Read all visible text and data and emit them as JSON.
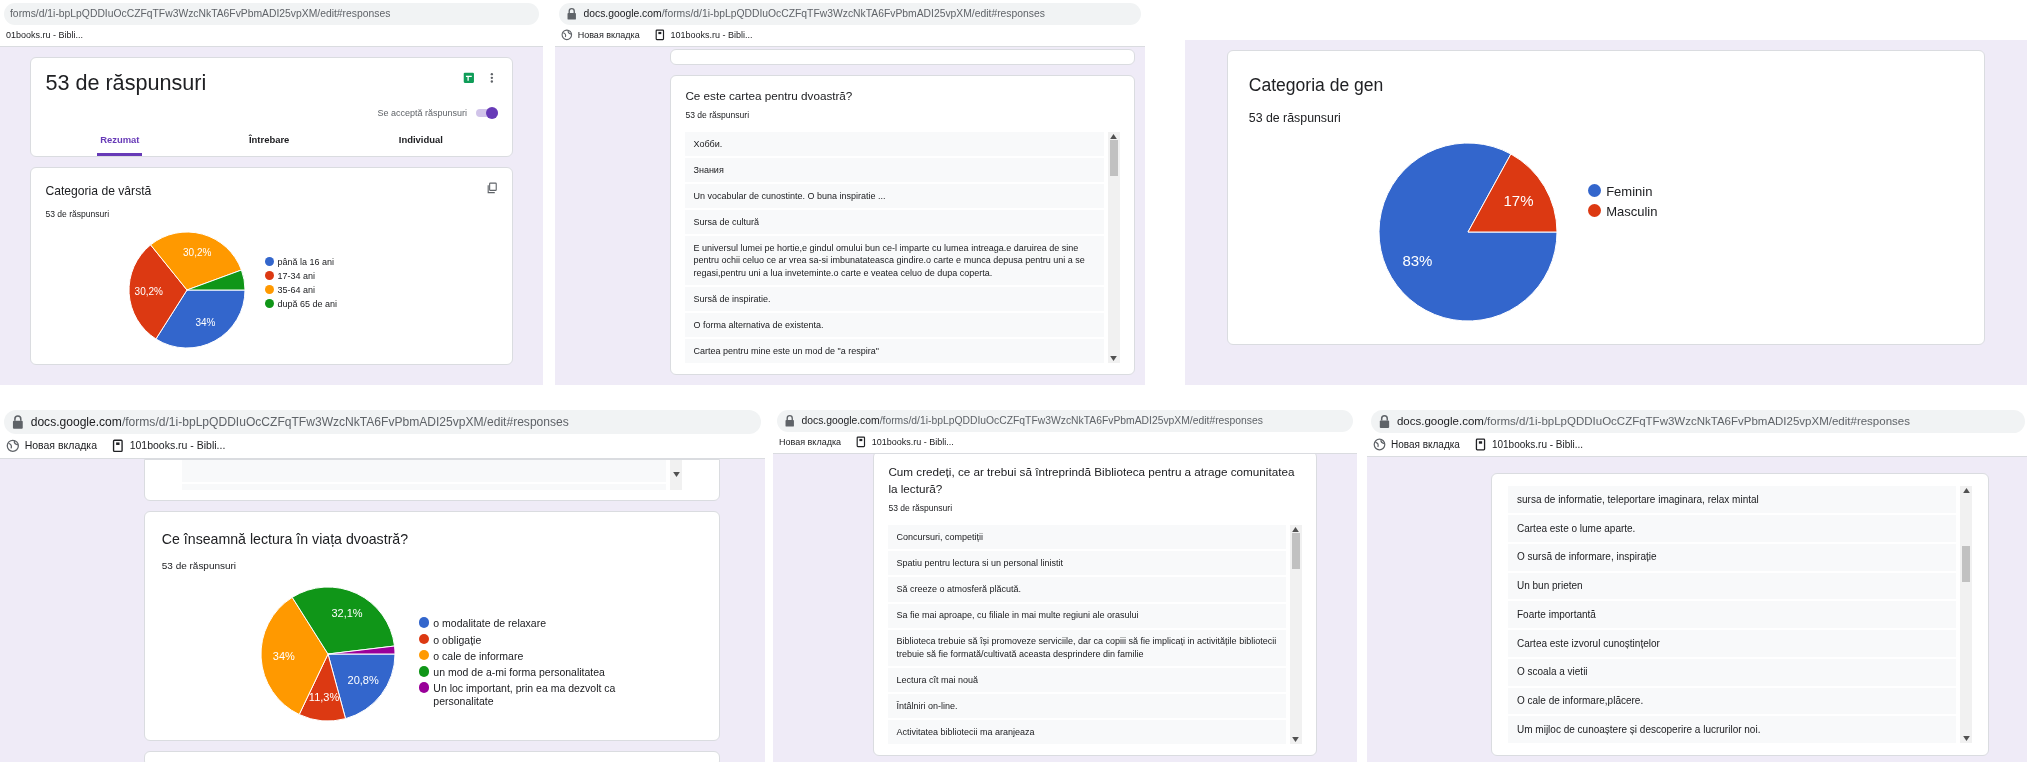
{
  "panels": [
    {
      "browser": {
        "url_path": "forms/d/1i-bpLpQDDIuOcCZFqTFw3WzcNkTA6FvPbmADI25vpXM/edit#responses",
        "bookmarks": [
          {
            "kind": "plain",
            "label": "01books.ru - Bibli..."
          }
        ]
      },
      "cards": [
        {
          "kind": "header",
          "title": "53 de răspunsuri",
          "toggle_label": "Se acceptă răspunsuri",
          "toggle_on": true,
          "tabs": [
            {
              "label": "Rezumat",
              "selected": true
            },
            {
              "label": "Întrebare",
              "selected": false
            },
            {
              "label": "Individual",
              "selected": false
            }
          ]
        },
        {
          "kind": "pie",
          "title": "Categoria de vârstă",
          "subtitle": "53 de răspunsuri",
          "copy": true,
          "chart_data": {
            "type": "pie",
            "categories": [
              "până la 16 ani",
              "17-34 ani",
              "35-64 ani",
              "după 65 de ani"
            ],
            "values": [
              34,
              30.2,
              30.2,
              5.6
            ],
            "colors": [
              "#3366cc",
              "#dc3912",
              "#ff9900",
              "#109618"
            ],
            "value_labels": [
              "34%",
              "30,2%",
              "30,2%",
              null
            ],
            "legend": "right"
          }
        }
      ]
    },
    {
      "browser": {
        "url_host": "docs.google.com",
        "url_path": "/forms/d/1i-bpLpQDDIuOcCZFqTFw3WzcNkTA6FvPbmADI25vpXM/edit#responses",
        "bookmarks": [
          {
            "kind": "globe",
            "label": "Новая вкладка"
          },
          {
            "kind": "book",
            "label": "101books.ru - Bibli..."
          }
        ]
      },
      "cards": [
        {
          "kind": "fragment"
        },
        {
          "kind": "responses",
          "title": "Ce este cartea pentru dvoastră?",
          "subtitle": "53 de răspunsuri",
          "responses": [
            "Хобби.",
            "Знания",
            "Un vocabular de cunostinte. O buna inspiratie ...",
            "Sursa de cultură",
            "E universul lumei pe hortie,e gindul omului bun ce-l imparte cu lumea intreaga.e daruirea de sine pentru ochii celuo ce ar vrea sa-si imbunatateasca gindire.o carte e munca depusa pentru uni a se regasi,pentru uni a lua inveteminte.o carte e veatea celuo de dupa coperta.",
            "Sursă de inspiratie.",
            "O forma alternativa de existenta.",
            "Cartea pentru mine este un mod de \"a respira\""
          ]
        }
      ]
    },
    {
      "cards": [
        {
          "kind": "pie",
          "title": "Categoria de gen",
          "subtitle": "53 de răspunsuri",
          "copy": false,
          "chart_data": {
            "type": "pie",
            "categories": [
              "Feminin",
              "Masculin"
            ],
            "values": [
              83,
              17
            ],
            "colors": [
              "#3366cc",
              "#dc3912"
            ],
            "value_labels": [
              "83%",
              "17%"
            ],
            "legend": "right"
          }
        }
      ]
    },
    {
      "browser": {
        "url_host": "docs.google.com",
        "url_path": "/forms/d/1i-bpLpQDDIuOcCZFqTFw3WzcNkTA6FvPbmADI25vpXM/edit#responses",
        "bookmarks": [
          {
            "kind": "globe",
            "label": "Новая вкладка"
          },
          {
            "kind": "book",
            "label": "101books.ru - Bibli..."
          }
        ]
      },
      "cards": [
        {
          "kind": "list_end"
        },
        {
          "kind": "pie",
          "title": "Ce înseamnă lectura în viața dvoastră?",
          "subtitle": "53 de răspunsuri",
          "copy": false,
          "chart_data": {
            "type": "pie",
            "categories": [
              "o modalitate de relaxare",
              "o obligație",
              "o cale de informare",
              "un mod de a-mi forma personalitatea",
              "Un loc important, prin ea ma dezvolt ca personalitate"
            ],
            "values": [
              20.8,
              11.3,
              34,
              32.1,
              1.9
            ],
            "colors": [
              "#3366cc",
              "#dc3912",
              "#ff9900",
              "#109618",
              "#990099"
            ],
            "value_labels": [
              "20,8%",
              "11,3%",
              "34%",
              "32,1%",
              null
            ],
            "legend": "right"
          }
        },
        {
          "kind": "fragment"
        }
      ]
    },
    {
      "browser": {
        "url_host": "docs.google.com",
        "url_path": "/forms/d/1i-bpLpQDDIuOcCZFqTFw3WzcNkTA6FvPbmADI25vpXM/edit#responses",
        "bookmarks": [
          {
            "kind": "plain",
            "label": "Новая вкладка"
          },
          {
            "kind": "book",
            "label": "101books.ru - Bibli..."
          }
        ]
      },
      "cards": [
        {
          "kind": "responses",
          "title": "Cum credeți, ce ar trebui să întreprindă Biblioteca pentru a atrage comunitatea la lectură?",
          "subtitle": "53 de răspunsuri",
          "responses": [
            "Concursuri, competiții",
            "Spatiu pentru lectura si un personal linistit",
            "Să creeze o atmosferă plăcută.",
            "Sa fie mai aproape, cu filiale in mai multe regiuni ale orasului",
            "Biblioteca trebuie să își promoveze serviciile, dar ca copiii să fie implicați in activitățile bibliotecii trebuie să fie formată/cultivată aceasta desprindere din familie",
            "Lectura cît mai nouă",
            "Întâlniri on-line.",
            "Activitatea bibliotecii ma aranjeaza"
          ]
        }
      ]
    },
    {
      "browser": {
        "url_host": "docs.google.com",
        "url_path": "/forms/d/1i-bpLpQDDIuOcCZFqTFw3WzcNkTA6FvPbmADI25vpXM/edit#responses",
        "bookmarks": [
          {
            "kind": "globe",
            "label": "Новая вкладка"
          },
          {
            "kind": "book",
            "label": "101books.ru - Bibli..."
          }
        ]
      },
      "cards": [
        {
          "kind": "responses",
          "responses": [
            "sursa de informatie, teleportare imaginara, relax mintal",
            "Cartea este o lume aparte.",
            "O sursă de informare, inspirație",
            "Un bun prieten",
            "Foarte importantă",
            "Cartea este izvorul cunoștințelor",
            "O scoala a vietii",
            "O cale de informare,plăcere.",
            "Um mijloc de cunoaștere și descoperire a lucrurilor noi."
          ]
        }
      ]
    }
  ]
}
